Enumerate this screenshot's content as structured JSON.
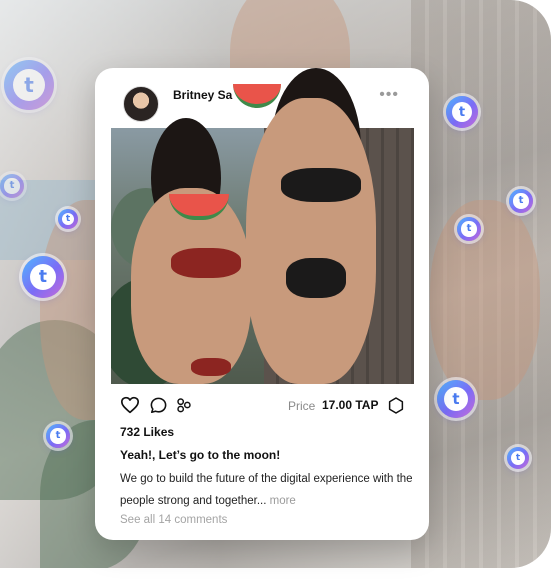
{
  "post": {
    "username": "Britney Sa",
    "handle": "@",
    "more_label": "•••",
    "price_label": "Price",
    "price_value": "17.00 TAP",
    "likes": "732 Likes",
    "caption_title": "Yeah!, Let’s go to the moon!",
    "caption_body": "We go to build the future of the digital experience with the people strong and together...",
    "more_link": "more",
    "comments_link": "See all 14 comments"
  },
  "icons": {
    "like": "heart-icon",
    "comment": "comment-icon",
    "share": "share-icon",
    "token": "hexagon-icon",
    "brand": "t-token-icon"
  },
  "brand_glyph": "t",
  "colors": {
    "token_gradient_start": "#4fb6ff",
    "token_gradient_mid": "#7b6cf6",
    "token_gradient_end": "#c56ad8",
    "card_background": "#ffffff",
    "text_primary": "#111111",
    "text_muted": "#a4a4a4"
  }
}
